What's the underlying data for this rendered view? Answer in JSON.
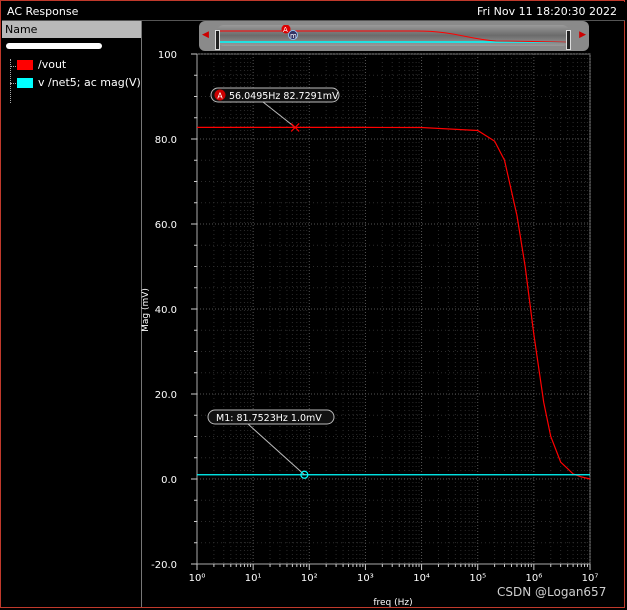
{
  "window": {
    "title": "AC Response",
    "timestamp": "Fri Nov 11 18:20:30 2022"
  },
  "left_panel": {
    "header": "Name",
    "legend": [
      {
        "label": "/vout",
        "color": "#ff0000"
      },
      {
        "label": "v /net5; ac mag(V)",
        "color": "#00ffff"
      }
    ]
  },
  "overview": {
    "marker_a": "A",
    "marker_m": "m"
  },
  "markers": {
    "a_badge": "A",
    "a_label": "56.0495Hz 82.7291mV",
    "m1_label": "M1: 81.7523Hz 1.0mV"
  },
  "watermark": "CSDN @Logan657",
  "chart_data": {
    "type": "line",
    "xlabel": "freq (Hz)",
    "ylabel": "Mag (mV)",
    "xscale": "log",
    "xlim": [
      1,
      10000000
    ],
    "ylim": [
      -20,
      100
    ],
    "x_tick_labels": [
      "10⁰",
      "10¹",
      "10²",
      "10³",
      "10⁴",
      "10⁵",
      "10⁶",
      "10⁷"
    ],
    "y_tick_labels": [
      "100",
      "80.0",
      "60.0",
      "40.0",
      "20.0",
      "0.0",
      "-20.0"
    ],
    "y_ticks": [
      100,
      80,
      60,
      40,
      20,
      0,
      -20
    ],
    "grid": true,
    "series": [
      {
        "name": "/vout",
        "color": "#ff0000",
        "x": [
          1,
          10,
          56.0495,
          100,
          1000,
          10000,
          100000,
          200000,
          300000,
          500000,
          700000,
          1000000,
          1500000,
          2000000,
          3000000,
          5000000,
          7000000,
          10000000
        ],
        "y": [
          82.73,
          82.73,
          82.7291,
          82.73,
          82.73,
          82.7,
          82.0,
          79.5,
          75.0,
          62.0,
          50.0,
          34.0,
          18.0,
          10.0,
          4.0,
          1.2,
          0.5,
          0.0
        ]
      },
      {
        "name": "v /net5; ac mag(V)",
        "color": "#00ffff",
        "x": [
          1,
          81.7523,
          10000000
        ],
        "y": [
          1.0,
          1.0,
          1.0
        ]
      }
    ],
    "annotations": [
      {
        "series": "/vout",
        "x": 56.0495,
        "y": 82.7291,
        "label": "56.0495Hz 82.7291mV"
      },
      {
        "series": "v /net5; ac mag(V)",
        "x": 81.7523,
        "y": 1.0,
        "label": "M1: 81.7523Hz 1.0mV"
      }
    ]
  }
}
